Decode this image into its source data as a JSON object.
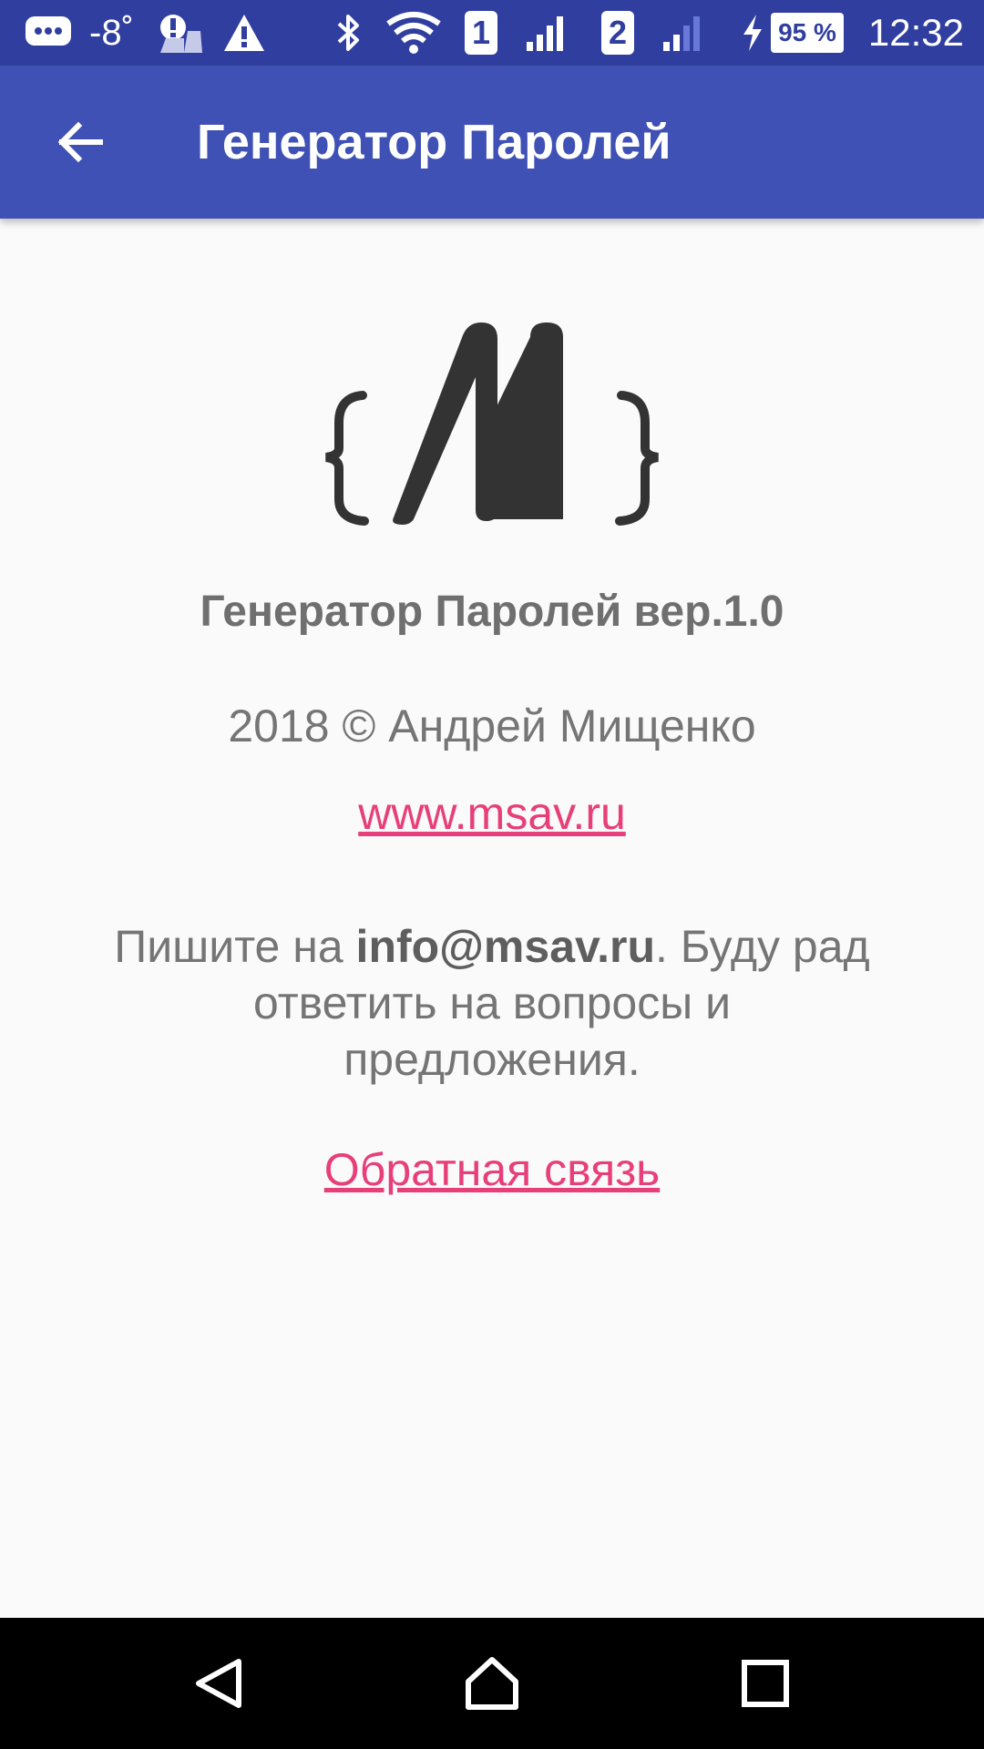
{
  "status_bar": {
    "temperature": "-8˚",
    "sim1": "1",
    "sim2": "2",
    "battery": "95 %",
    "time": "12:32",
    "icons": [
      "message-icon",
      "alert-bubble-icon",
      "warning-icon",
      "bluetooth-icon",
      "wifi-icon",
      "signal-icon",
      "charging-icon",
      "battery-icon"
    ]
  },
  "app_bar": {
    "title": "Генератор Паролей",
    "back_icon": "arrow-left-icon"
  },
  "about": {
    "logo_icon": "msav-logo-icon",
    "title": "Генератор Паролей вер.1.0",
    "copyright": "2018 © Андрей Мищенко",
    "website": "www.msav.ru",
    "contact_prefix": "Пишите на ",
    "contact_email": "info@msav.ru",
    "contact_suffix": ". Буду рад ответить на вопросы и предложения.",
    "feedback": "Обратная связь"
  },
  "colors": {
    "status_bar": "#303f9f",
    "app_bar": "#3f51b5",
    "link": "#e73f79",
    "text": "#757575",
    "background": "#fafafa"
  },
  "nav_bar": {
    "icons": [
      "back-triangle-icon",
      "home-icon",
      "recents-icon"
    ]
  }
}
